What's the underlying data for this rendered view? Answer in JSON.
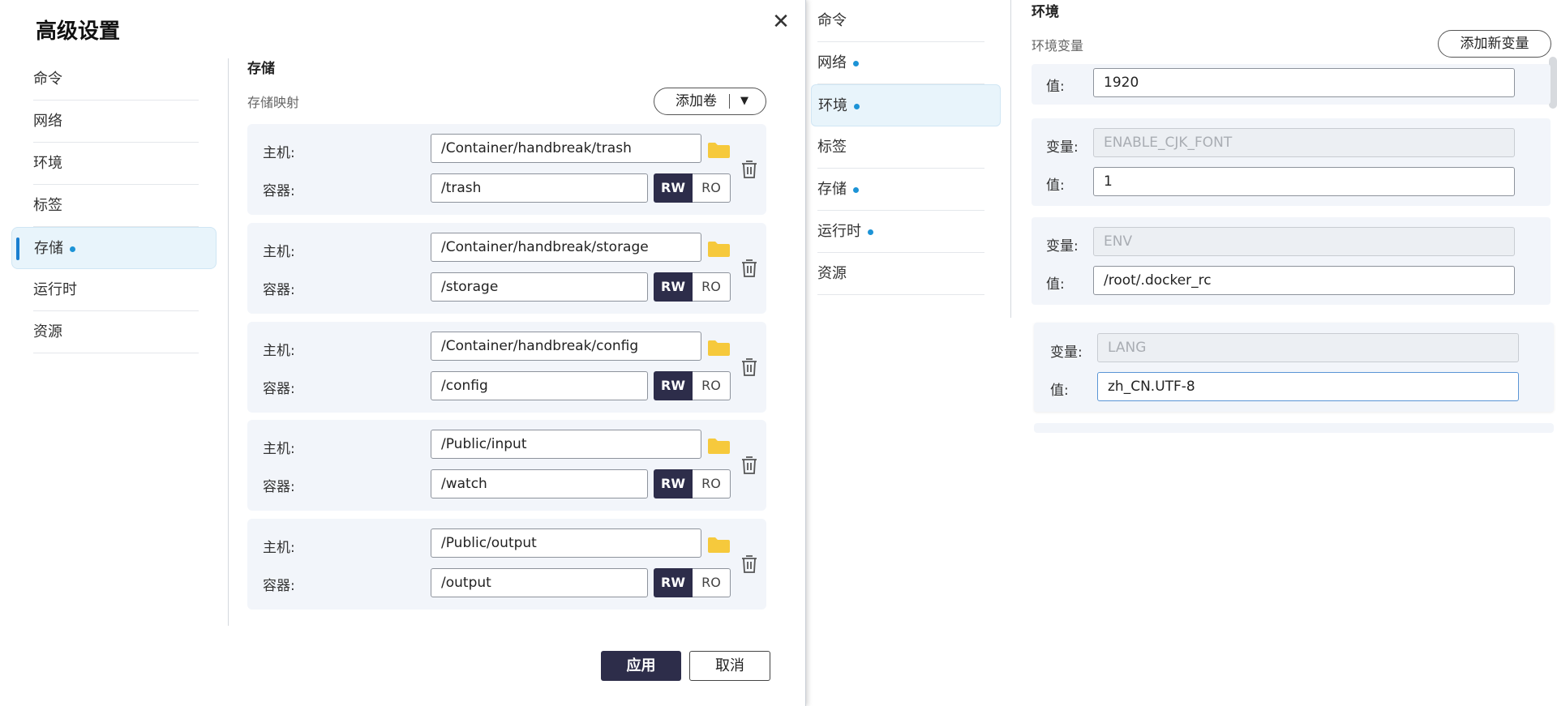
{
  "dialog": {
    "title": "高级设置",
    "close_label": "✕",
    "nav": [
      {
        "label": "命令",
        "dot": false
      },
      {
        "label": "网络",
        "dot": false
      },
      {
        "label": "环境",
        "dot": false
      },
      {
        "label": "标签",
        "dot": false
      },
      {
        "label": "存储",
        "dot": true,
        "active": true
      },
      {
        "label": "运行时",
        "dot": false
      },
      {
        "label": "资源",
        "dot": false
      }
    ],
    "storage": {
      "section_title": "存储",
      "subtitle": "存储映射",
      "add_volume_label": "添加卷",
      "host_label": "主机:",
      "container_label": "容器:",
      "rw_label": "RW",
      "ro_label": "RO",
      "mappings": [
        {
          "host": "/Container/handbreak/trash",
          "container": "/trash"
        },
        {
          "host": "/Container/handbreak/storage",
          "container": "/storage"
        },
        {
          "host": "/Container/handbreak/config",
          "container": "/config"
        },
        {
          "host": "/Public/input",
          "container": "/watch"
        },
        {
          "host": "/Public/output",
          "container": "/output"
        }
      ]
    },
    "apply_label": "应用",
    "cancel_label": "取消"
  },
  "mid_nav": [
    {
      "label": "命令",
      "dot": false
    },
    {
      "label": "网络",
      "dot": true
    },
    {
      "label": "环境",
      "dot": true,
      "active": true
    },
    {
      "label": "标签",
      "dot": false
    },
    {
      "label": "存储",
      "dot": true
    },
    {
      "label": "运行时",
      "dot": true
    },
    {
      "label": "资源",
      "dot": false
    }
  ],
  "env": {
    "section_title": "环境",
    "subtitle": "环境变量",
    "add_variable_label": "添加新变量",
    "variable_label": "变量:",
    "value_label": "值:",
    "rows": [
      {
        "value": "1920"
      },
      {
        "variable": "ENABLE_CJK_FONT",
        "value": "1"
      },
      {
        "variable": "ENV",
        "value": "/root/.docker_rc"
      },
      {
        "variable": "LANG",
        "value": "zh_CN.UTF-8"
      }
    ]
  },
  "colors": {
    "accent_dark": "#2d2d4a",
    "active_bg": "#e8f4fb",
    "dot": "#1c93d6",
    "folder": "#f6c93c",
    "card_bg": "#f2f5fa"
  }
}
